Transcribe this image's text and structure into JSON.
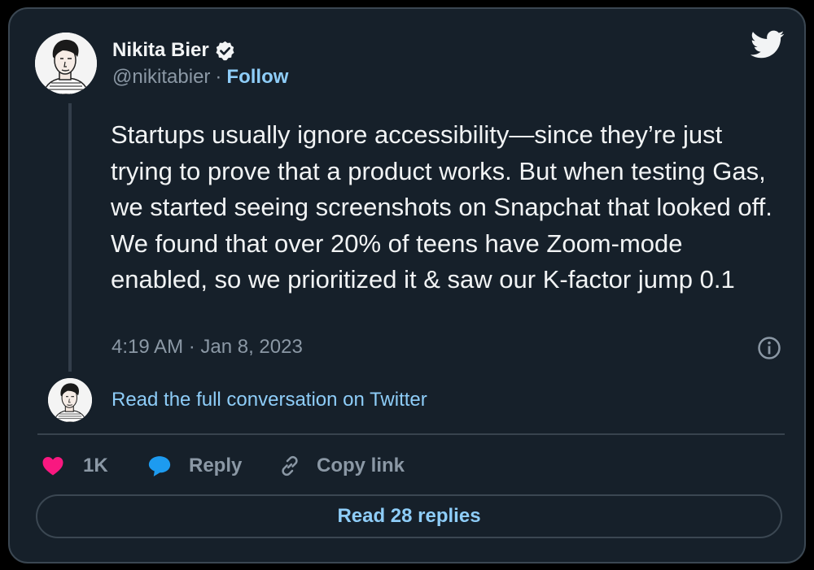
{
  "author": {
    "name": "Nikita Bier",
    "handle": "@nikitabier",
    "separator": "·",
    "follow_label": "Follow"
  },
  "tweet": {
    "text": "Startups usually ignore accessibility—since they’re just trying to prove that a product works. But when testing Gas, we started seeing screenshots on Snapchat that looked off. We found that over 20% of teens have Zoom-mode enabled, so we prioritized it & saw our K-factor jump 0.1",
    "timestamp": "4:19 AM · Jan 8, 2023"
  },
  "conversation_link": "Read the full conversation on Twitter",
  "actions": {
    "like_count": "1K",
    "reply_label": "Reply",
    "copy_link_label": "Copy link"
  },
  "read_replies_label": "Read 28 replies",
  "icons": {
    "brand": "twitter-bird-icon",
    "verified": "verified-badge-icon",
    "info": "info-icon",
    "like": "heart-icon",
    "reply": "speech-bubble-icon",
    "copy": "link-icon"
  },
  "colors": {
    "background": "#16202a",
    "link": "#8ecdf8",
    "like": "#f91880",
    "reply": "#1d9bf0",
    "muted": "#8b98a5"
  }
}
